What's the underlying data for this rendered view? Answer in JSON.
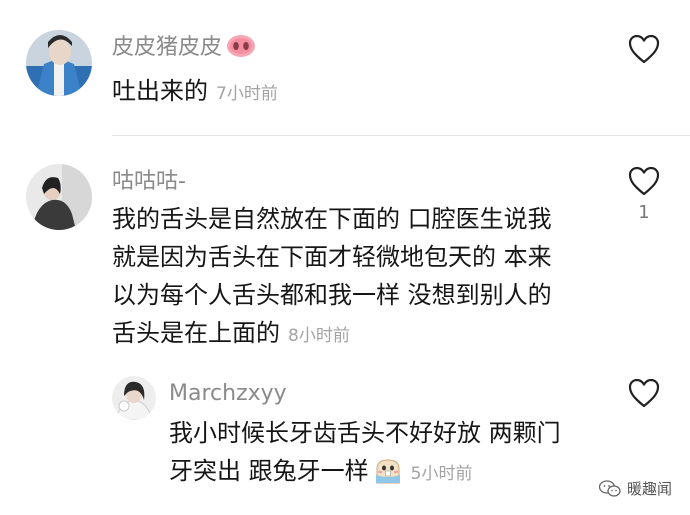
{
  "comments": [
    {
      "username": "皮皮猪皮皮",
      "username_emoji": "pig-nose-icon",
      "lines": [
        "吐出来的"
      ],
      "time": "7小时前",
      "likes": ""
    },
    {
      "username": "咕咕咕-",
      "lines": [
        "我的舌头是自然放在下面的 口腔医生说我",
        "就是因为舌头在下面才轻微地包天的 本来",
        "以为每个人舌头都和我一样 没想到别人的",
        "舌头是在上面的"
      ],
      "time": "8小时前",
      "likes": "1"
    },
    {
      "username": "Marchzxyy",
      "lines": [
        "我小时候长牙齿舌头不好好放 两颗门",
        "牙突出 跟兔牙一样"
      ],
      "time": "5小时前",
      "likes": "",
      "trailing_emoji": "bunny-teeth-emoji-icon"
    }
  ],
  "watermark": {
    "label": "暖趣闻",
    "icon": "wechat-logo-icon"
  },
  "colors": {
    "username": "#8a8a8a",
    "body_text": "#161616",
    "time": "#a3a3a3",
    "divider": "#e6e6e6",
    "heart_stroke": "#222222"
  }
}
